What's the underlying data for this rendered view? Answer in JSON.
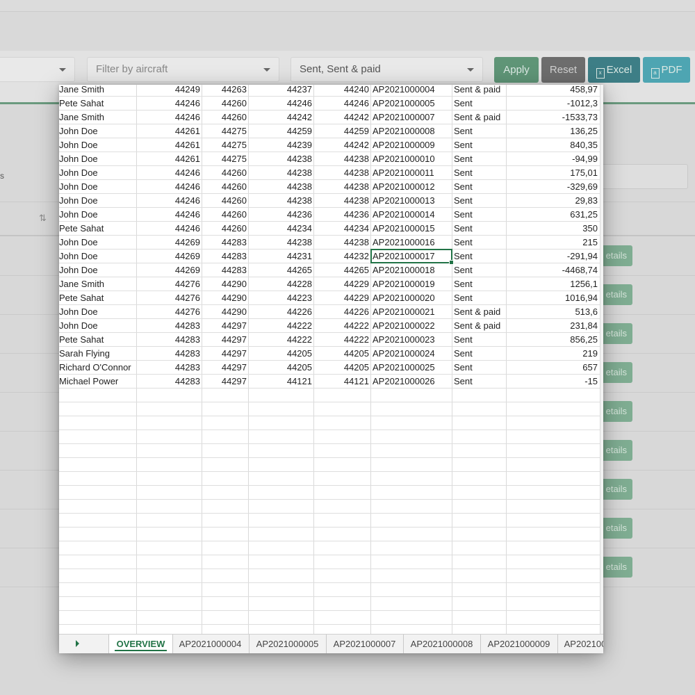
{
  "filters": {
    "aircraft_placeholder": "Filter by aircraft",
    "status_value": "Sent, Sent & paid"
  },
  "buttons": {
    "apply": "Apply",
    "reset": "Reset",
    "excel": "Excel",
    "pdf": "PDF",
    "details": "etails"
  },
  "background": {
    "s_text": "s"
  },
  "sheet": {
    "selected_cell": "AP2021000017",
    "rows": [
      {
        "name": "Jane Smith",
        "n1": "44249",
        "n2": "44263",
        "n3": "44237",
        "n4": "44240",
        "id": "AP2021000004",
        "status": "Sent & paid",
        "amount": "458,97"
      },
      {
        "name": "Pete Sahat",
        "n1": "44246",
        "n2": "44260",
        "n3": "44246",
        "n4": "44246",
        "id": "AP2021000005",
        "status": "Sent",
        "amount": "-1012,3"
      },
      {
        "name": "Jane Smith",
        "n1": "44246",
        "n2": "44260",
        "n3": "44242",
        "n4": "44242",
        "id": "AP2021000007",
        "status": "Sent & paid",
        "amount": "-1533,73"
      },
      {
        "name": "John Doe",
        "n1": "44261",
        "n2": "44275",
        "n3": "44259",
        "n4": "44259",
        "id": "AP2021000008",
        "status": "Sent",
        "amount": "136,25"
      },
      {
        "name": "John Doe",
        "n1": "44261",
        "n2": "44275",
        "n3": "44239",
        "n4": "44242",
        "id": "AP2021000009",
        "status": "Sent",
        "amount": "840,35"
      },
      {
        "name": "John Doe",
        "n1": "44261",
        "n2": "44275",
        "n3": "44238",
        "n4": "44238",
        "id": "AP2021000010",
        "status": "Sent",
        "amount": "-94,99"
      },
      {
        "name": "John Doe",
        "n1": "44246",
        "n2": "44260",
        "n3": "44238",
        "n4": "44238",
        "id": "AP2021000011",
        "status": "Sent",
        "amount": "175,01"
      },
      {
        "name": "John Doe",
        "n1": "44246",
        "n2": "44260",
        "n3": "44238",
        "n4": "44238",
        "id": "AP2021000012",
        "status": "Sent",
        "amount": "-329,69"
      },
      {
        "name": "John Doe",
        "n1": "44246",
        "n2": "44260",
        "n3": "44238",
        "n4": "44238",
        "id": "AP2021000013",
        "status": "Sent",
        "amount": "29,83"
      },
      {
        "name": "John Doe",
        "n1": "44246",
        "n2": "44260",
        "n3": "44236",
        "n4": "44236",
        "id": "AP2021000014",
        "status": "Sent",
        "amount": "631,25"
      },
      {
        "name": "Pete Sahat",
        "n1": "44246",
        "n2": "44260",
        "n3": "44234",
        "n4": "44234",
        "id": "AP2021000015",
        "status": "Sent",
        "amount": "350"
      },
      {
        "name": "John Doe",
        "n1": "44269",
        "n2": "44283",
        "n3": "44238",
        "n4": "44238",
        "id": "AP2021000016",
        "status": "Sent",
        "amount": "215"
      },
      {
        "name": "John Doe",
        "n1": "44269",
        "n2": "44283",
        "n3": "44231",
        "n4": "44232",
        "id": "AP2021000017",
        "status": "Sent",
        "amount": "-291,94"
      },
      {
        "name": "John Doe",
        "n1": "44269",
        "n2": "44283",
        "n3": "44265",
        "n4": "44265",
        "id": "AP2021000018",
        "status": "Sent",
        "amount": "-4468,74"
      },
      {
        "name": "Jane Smith",
        "n1": "44276",
        "n2": "44290",
        "n3": "44228",
        "n4": "44229",
        "id": "AP2021000019",
        "status": "Sent",
        "amount": "1256,1"
      },
      {
        "name": "Pete Sahat",
        "n1": "44276",
        "n2": "44290",
        "n3": "44223",
        "n4": "44229",
        "id": "AP2021000020",
        "status": "Sent",
        "amount": "1016,94"
      },
      {
        "name": "John Doe",
        "n1": "44276",
        "n2": "44290",
        "n3": "44226",
        "n4": "44226",
        "id": "AP2021000021",
        "status": "Sent & paid",
        "amount": "513,6"
      },
      {
        "name": "John Doe",
        "n1": "44283",
        "n2": "44297",
        "n3": "44222",
        "n4": "44222",
        "id": "AP2021000022",
        "status": "Sent & paid",
        "amount": "231,84"
      },
      {
        "name": "Pete Sahat",
        "n1": "44283",
        "n2": "44297",
        "n3": "44222",
        "n4": "44222",
        "id": "AP2021000023",
        "status": "Sent",
        "amount": "856,25"
      },
      {
        "name": "Sarah Flying",
        "n1": "44283",
        "n2": "44297",
        "n3": "44205",
        "n4": "44205",
        "id": "AP2021000024",
        "status": "Sent",
        "amount": "219"
      },
      {
        "name": "Richard O'Connor",
        "n1": "44283",
        "n2": "44297",
        "n3": "44205",
        "n4": "44205",
        "id": "AP2021000025",
        "status": "Sent",
        "amount": "657"
      },
      {
        "name": "Michael Power",
        "n1": "44283",
        "n2": "44297",
        "n3": "44121",
        "n4": "44121",
        "id": "AP2021000026",
        "status": "Sent",
        "amount": "-15"
      }
    ],
    "tabs": [
      "OVERVIEW",
      "AP2021000004",
      "AP2021000005",
      "AP2021000007",
      "AP2021000008",
      "AP2021000009",
      "AP202100"
    ],
    "active_tab": "OVERVIEW"
  },
  "colors": {
    "excel_green": "#217346",
    "apply": "#5f9577",
    "reset": "#6d6d6d",
    "excel_button": "#3d7e86",
    "pdf_button": "#4ea5b2"
  },
  "icons": [
    "chevron-down-icon",
    "excel-file-icon",
    "pdf-file-icon",
    "sort-icon",
    "tab-scroll-right-icon"
  ]
}
